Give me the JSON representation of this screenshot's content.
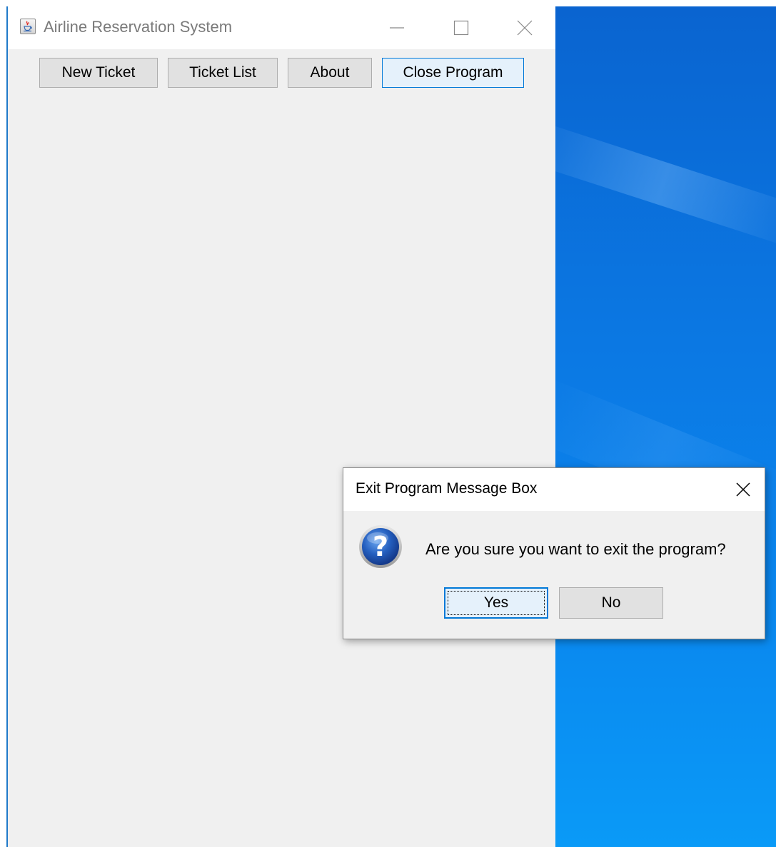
{
  "main_window": {
    "title": "Airline Reservation System",
    "toolbar": {
      "buttons": [
        {
          "label": "New Ticket"
        },
        {
          "label": "Ticket List"
        },
        {
          "label": "About"
        },
        {
          "label": "Close Program"
        }
      ]
    }
  },
  "dialog": {
    "title": "Exit Program Message Box",
    "message": "Are you sure you want to exit the program?",
    "yes_label": "Yes",
    "no_label": "No"
  },
  "colors": {
    "accent": "#0078d7",
    "window_bg": "#f0f0f0",
    "desktop_blue": "#0b78e3"
  },
  "icons": {
    "app": "java-cup-icon",
    "dialog": "question-icon"
  }
}
